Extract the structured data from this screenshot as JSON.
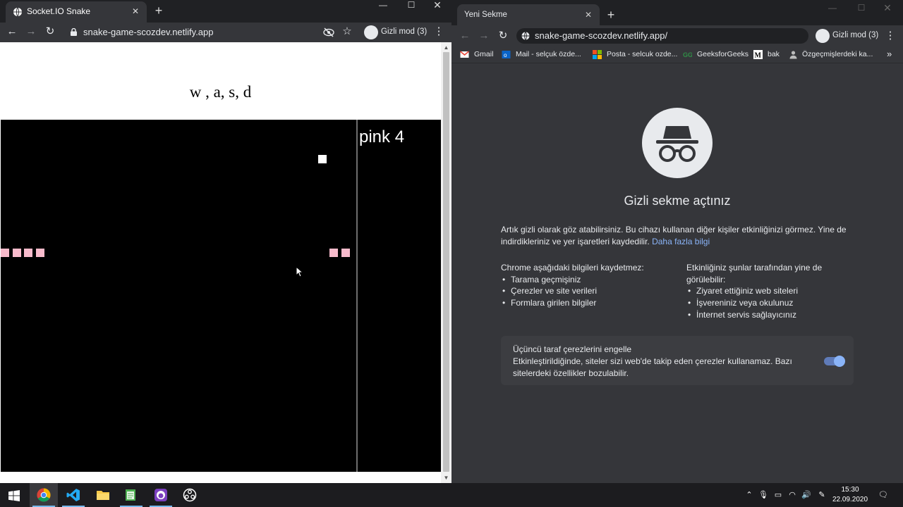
{
  "left_window": {
    "tab_title": "Socket.IO Snake",
    "url": "snake-game-scozdev.netlify.app",
    "incognito_label": "Gizli mod (3)",
    "page": {
      "controls_hint": "w , a, s, d",
      "score_label": "pink 4",
      "snake_color": "#f8bbcc",
      "food_color": "#ffffff"
    }
  },
  "right_window": {
    "tab_title": "Yeni Sekme",
    "url": "snake-game-scozdev.netlify.app/",
    "incognito_label": "Gizli mod (3)",
    "bookmarks": [
      "Gmail",
      "Mail - selçuk özde...",
      "Posta - selcuk ozde...",
      "GeeksforGeeks",
      "bak",
      "Özgeçmişlerdeki ka..."
    ],
    "incognito_page": {
      "title": "Gizli sekme açtınız",
      "intro": "Artık gizli olarak göz atabilirsiniz. Bu cihazı kullanan diğer kişiler etkinliğinizi görmez. Yine de indirdikleriniz ve yer işaretleri kaydedilir.",
      "learn_more": "Daha fazla bilgi",
      "not_saved_heading": "Chrome aşağıdaki bilgileri kaydetmez:",
      "not_saved_items": [
        "Tarama geçmişiniz",
        "Çerezler ve site verileri",
        "Formlara girilen bilgiler"
      ],
      "visible_heading": "Etkinliğiniz şunlar tarafından yine de görülebilir:",
      "visible_items": [
        "Ziyaret ettiğiniz web siteleri",
        "İşvereniniz veya okulunuz",
        "İnternet servis sağlayıcınız"
      ],
      "cookie_title": "Üçüncü taraf çerezlerini engelle",
      "cookie_desc": "Etkinleştirildiğinde, siteler sizi web'de takip eden çerezler kullanamaz. Bazı sitelerdeki özellikler bozulabilir.",
      "cookie_toggle_on": true
    }
  },
  "taskbar": {
    "apps": [
      "windows-start",
      "chrome",
      "vscode",
      "file-explorer",
      "notepad",
      "github-desktop",
      "obs"
    ],
    "time": "15:30",
    "date": "22.09.2020"
  }
}
